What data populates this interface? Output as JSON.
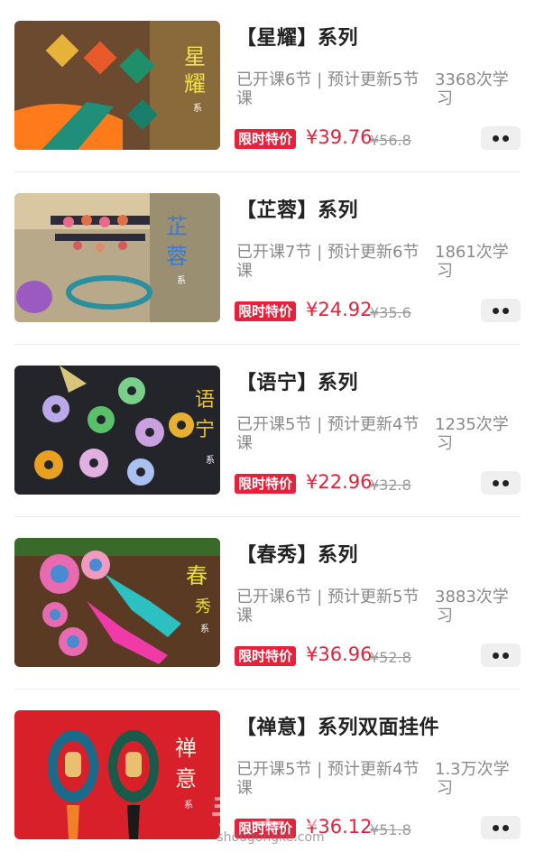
{
  "courses": [
    {
      "title": "【星耀】系列",
      "opened": "已开课6节",
      "sep": "|",
      "planned": "预计更新5节",
      "wrap": "课",
      "learners": "3368次学",
      "learners_wrap": "习",
      "badge": "限时特价",
      "price": "¥39.76",
      "original_price": "¥56.8",
      "image_text": "星耀",
      "image_sub": "系列"
    },
    {
      "title": "【芷蓉】系列",
      "opened": "已开课7节",
      "sep": "|",
      "planned": "预计更新6节",
      "wrap": "课",
      "learners": "1861次学",
      "learners_wrap": "习",
      "badge": "限时特价",
      "price": "¥24.92",
      "original_price": "¥35.6",
      "image_text": "芷蓉",
      "image_sub": "系列"
    },
    {
      "title": "【语宁】系列",
      "opened": "已开课5节",
      "sep": "|",
      "planned": "预计更新4节",
      "wrap": "课",
      "learners": "1235次学",
      "learners_wrap": "习",
      "badge": "限时特价",
      "price": "¥22.96",
      "original_price": "¥32.8",
      "image_text": "语宁",
      "image_sub": "系列"
    },
    {
      "title": "【春秀】系列",
      "opened": "已开课6节",
      "sep": "|",
      "planned": "预计更新5节",
      "wrap": "课",
      "learners": "3883次学",
      "learners_wrap": "习",
      "badge": "限时特价",
      "price": "¥36.96",
      "original_price": "¥52.8",
      "image_text": "春秀",
      "image_sub": "系列"
    },
    {
      "title": "【禅意】系列双面挂件",
      "opened": "已开课5节",
      "sep": "|",
      "planned": "预计更新4节",
      "wrap": "课",
      "learners": "1.3万次学",
      "learners_wrap": "习",
      "badge": "限时特价",
      "price": "¥36.12",
      "original_price": "¥51.8",
      "image_text": "禅意",
      "image_sub": "系列"
    }
  ],
  "more_icon": "more-dots-icon",
  "watermark": {
    "logo": "手工客",
    "url": "shougongke.com"
  },
  "colors": {
    "accent": "#e8203a",
    "muted": "#8a8a8a"
  }
}
